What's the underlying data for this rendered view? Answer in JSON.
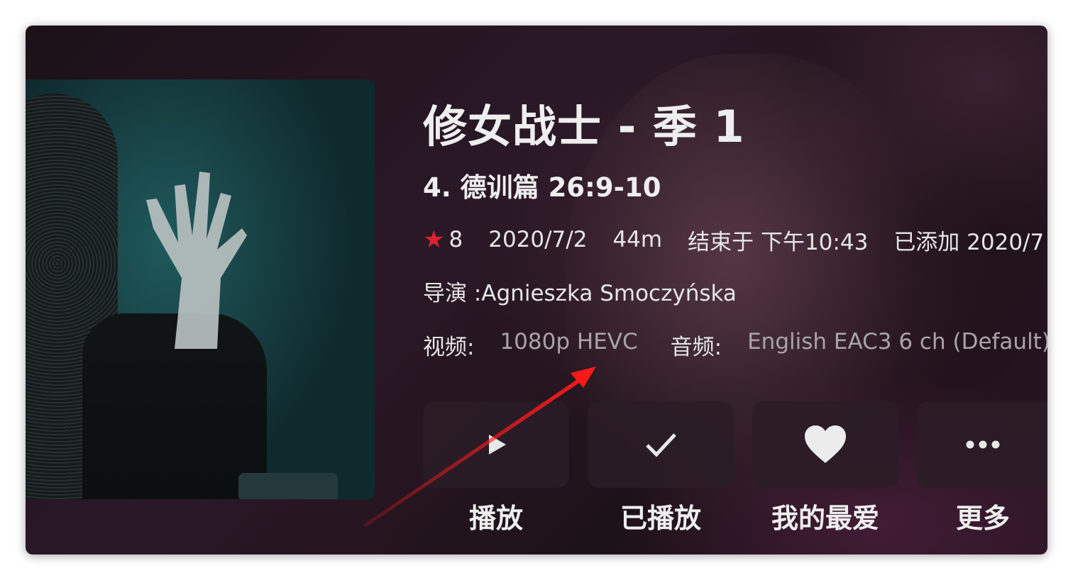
{
  "series": {
    "title": "修女战士 - 季 1"
  },
  "episode": {
    "title": "4. 德训篇 26:9-10"
  },
  "meta": {
    "rating": "8",
    "date": "2020/7/2",
    "runtime": "44m",
    "ends_at": "结束于 下午10:43",
    "added": "已添加 2020/7"
  },
  "director": {
    "text": "导演 :Agnieszka Smoczyńska"
  },
  "streams": {
    "video_label": "视频:",
    "video_value": "1080p HEVC",
    "audio_label": "音频:",
    "audio_value": "English EAC3 6 ch (Default)"
  },
  "actions": {
    "play": "播放",
    "played": "已播放",
    "favorite": "我的最爱",
    "more": "更多"
  },
  "colors": {
    "star": "#d9232e",
    "annotation_arrow": "#ff1a1a"
  }
}
